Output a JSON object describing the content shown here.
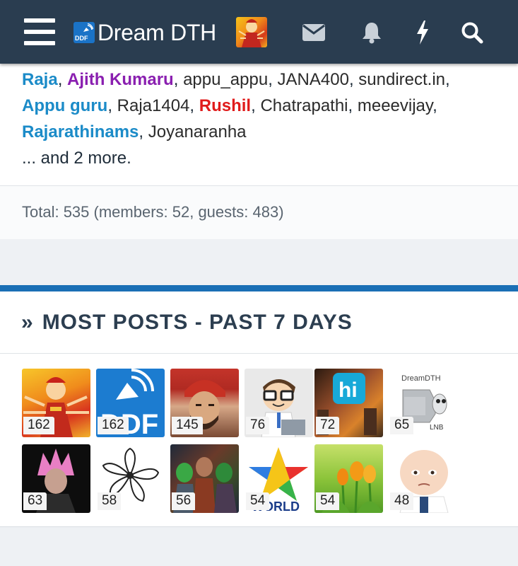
{
  "header": {
    "logo_badge": "DDF",
    "logo_text": "Dream DTH",
    "icons": [
      "menu-icon",
      "envelope-icon",
      "bell-icon",
      "bolt-icon",
      "search-icon"
    ],
    "colors": {
      "bar": "#2a3d50",
      "accent": "#1a6fb5"
    }
  },
  "online": {
    "users": [
      {
        "name": "Raja",
        "style": "blue"
      },
      {
        "name": "Ajith Kumaru",
        "style": "purple"
      },
      {
        "name": "appu_appu",
        "style": "plain"
      },
      {
        "name": "JANA400",
        "style": "plain"
      },
      {
        "name": "sundirect.in",
        "style": "plain"
      },
      {
        "name": "Appu guru",
        "style": "blue"
      },
      {
        "name": "Raja1404",
        "style": "plain"
      },
      {
        "name": "Rushil",
        "style": "red"
      },
      {
        "name": "Chatrapathi",
        "style": "plain"
      },
      {
        "name": "meeevijay",
        "style": "plain"
      },
      {
        "name": "Rajarathinams",
        "style": "blue"
      },
      {
        "name": "Joyanaranha",
        "style": "plain"
      }
    ],
    "more": "... and 2 more.",
    "total": "Total: 535 (members: 52, guests: 483)"
  },
  "most_posts": {
    "title": "MOST POSTS - PAST 7 DAYS",
    "chevron": "»",
    "tiles": [
      {
        "count": "162",
        "bg": "linear-gradient(160deg,#f7c62a 0%,#f08c1c 40%,#d8341e 70%,#f1b22a 100%)"
      },
      {
        "count": "162",
        "bg": "#1c7cd0"
      },
      {
        "count": "145",
        "bg": "linear-gradient(180deg,#c4342a 0%,#b02a22 30%,#d7a888 55%,#7a4a34 100%)"
      },
      {
        "count": "76",
        "bg": "#e9e9e9"
      },
      {
        "count": "72",
        "bg": "linear-gradient(135deg,#2b1a10 0%,#a0522d 45%,#d9822b 70%,#3d2a1c 100%)"
      },
      {
        "count": "65",
        "bg": "#ffffff"
      },
      {
        "count": "63",
        "bg": "#0d0d0d"
      },
      {
        "count": "58",
        "bg": "#ffffff"
      },
      {
        "count": "56",
        "bg": "linear-gradient(135deg,#1f2a3a 0%,#6a3a2a 40%,#3a4a2a 70%,#20283a 100%)"
      },
      {
        "count": "54",
        "bg": "#ffffff"
      },
      {
        "count": "54",
        "bg": "linear-gradient(180deg,#c6e06a 0%,#8cc43a 50%,#4f9a24 100%)"
      },
      {
        "count": "48",
        "bg": "#ffffff"
      }
    ],
    "tile_text": {
      "ddf": "DDF",
      "world": "WORLD",
      "lnb_brand": "DreamDTH",
      "lnb": "LNB"
    }
  }
}
